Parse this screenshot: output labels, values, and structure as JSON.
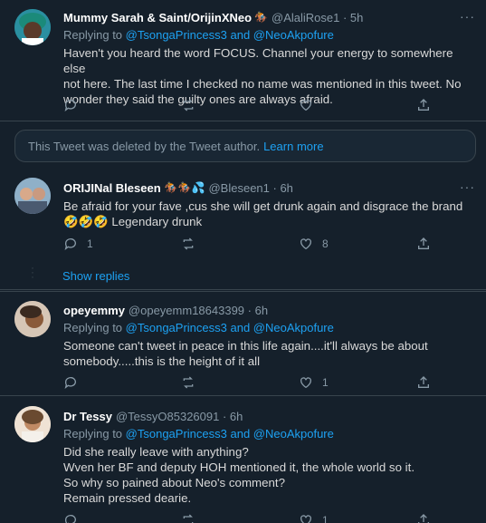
{
  "tweets": [
    {
      "name": "Mummy Sarah & Saint/OrijinXNeo",
      "badge": "🏇",
      "handle": "@AlaliRose1 · 5h",
      "replying_to": "Replying to",
      "mentions": "@TsongaPrincess3 and @NeoAkpofure",
      "lines": [
        "Haven't you heard the word FOCUS. Channel your energy to somewhere else",
        "not here. The last time I checked no name was mentioned in this tweet. No",
        "wonder they said the guilty ones are always afraid."
      ],
      "reply_count": "",
      "retweet_count": "",
      "like_count": ""
    },
    {
      "name": "ORIJINal Bleseen",
      "badge": "🏇🏇💦",
      "handle": "@Bleseen1 · 6h",
      "lines": [
        "Be afraid for your fave ,cus she will get drunk again and disgrace the brand",
        "Legendary drunk"
      ],
      "emoji_prefix": "🤣🤣🤣",
      "reply_count": "1",
      "retweet_count": "",
      "like_count": "8"
    },
    {
      "name": "opeyemmy",
      "handle": "@opeyemm18643399 · 6h",
      "replying_to": "Replying to",
      "mentions": "@TsongaPrincess3 and @NeoAkpofure",
      "lines": [
        "Someone can't tweet in peace in this life again....it'll always be about",
        "somebody.....this is the height of it all"
      ],
      "reply_count": "",
      "retweet_count": "",
      "like_count": "1"
    },
    {
      "name": "Dr Tessy",
      "handle": "@TessyO85326091 · 6h",
      "replying_to": "Replying to",
      "mentions": "@TsongaPrincess3 and @NeoAkpofure",
      "lines": [
        "Did she really leave with anything?",
        "Wven her BF and deputy HOH mentioned it, the whole world so it.",
        "So why so pained about Neo's comment?",
        "Remain pressed dearie."
      ],
      "reply_count": "",
      "retweet_count": "",
      "like_count": "1"
    }
  ],
  "deleted_notice": {
    "text": "This Tweet was deleted by the Tweet author.",
    "link": "Learn more"
  },
  "show_replies": "Show replies",
  "more_icon": "···",
  "colors": {
    "background": "#15202b",
    "link": "#1da1f2",
    "muted": "#8899a6",
    "border": "#38444d"
  }
}
